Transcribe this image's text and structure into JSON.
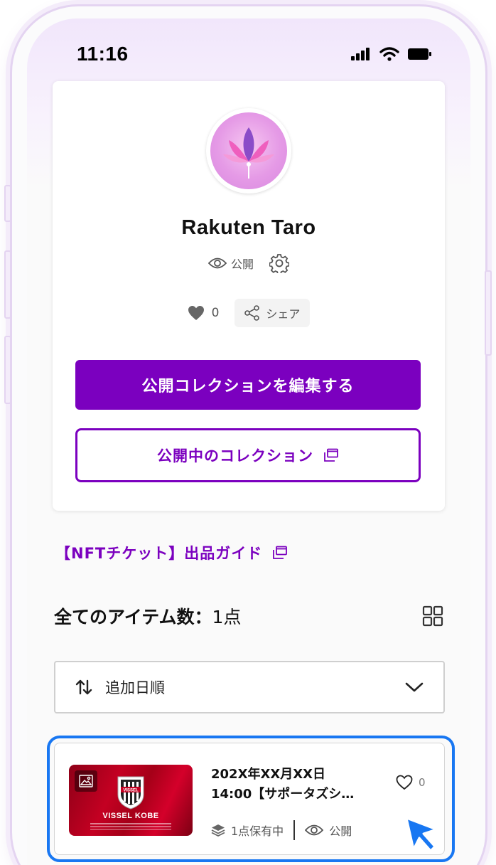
{
  "status_bar": {
    "time": "11:16"
  },
  "profile": {
    "name": "Rakuten Taro",
    "visibility_label": "公開",
    "likes_count": "0",
    "share_label": "シェア",
    "edit_button_label": "公開コレクションを編集する",
    "public_collection_label": "公開中のコレクション"
  },
  "guide_link_label": "【NFTチケット】出品ガイド",
  "items_summary": {
    "label": "全てのアイテム数：",
    "count": "1点"
  },
  "sort": {
    "selected": "追加日順"
  },
  "item": {
    "title_line1": "202X年XX月XX日",
    "title_line2": "14:00【サポータズシ…",
    "likes": "0",
    "owned_label": "1点保有中",
    "visibility_label": "公開",
    "thumbnail_title": "VISSEL KOBE",
    "crest_text": "VISSEL"
  },
  "colors": {
    "brand_purple": "#7b00bf",
    "highlight_blue": "#1877f2",
    "thumbnail_red": "#c40022"
  }
}
